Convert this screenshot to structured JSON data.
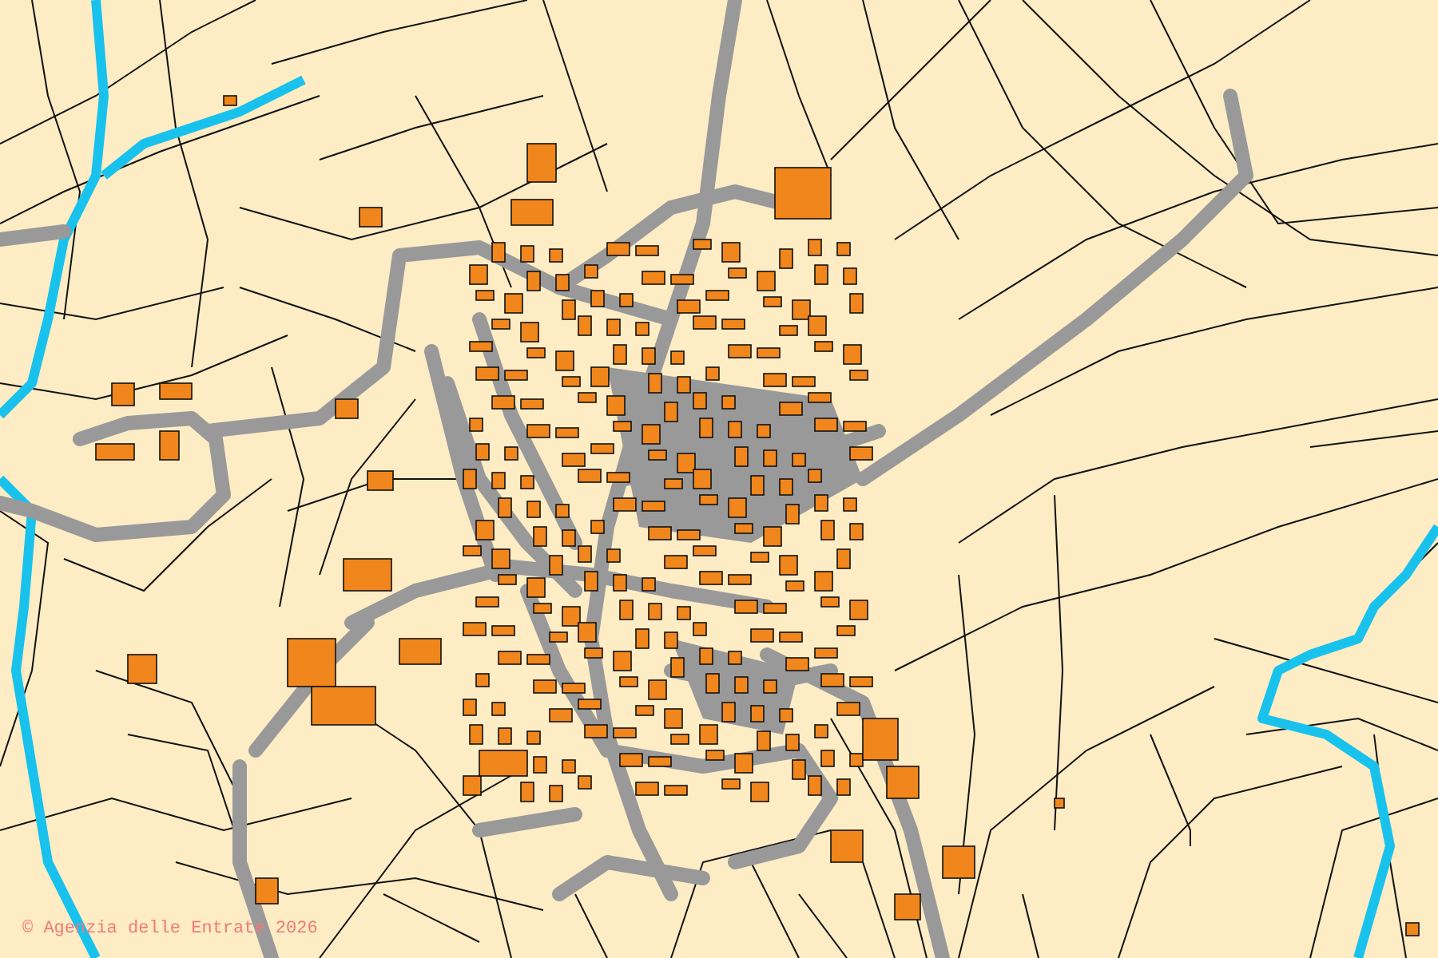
{
  "map": {
    "attribution": "© Agenzia delle Entrate 2026"
  }
}
